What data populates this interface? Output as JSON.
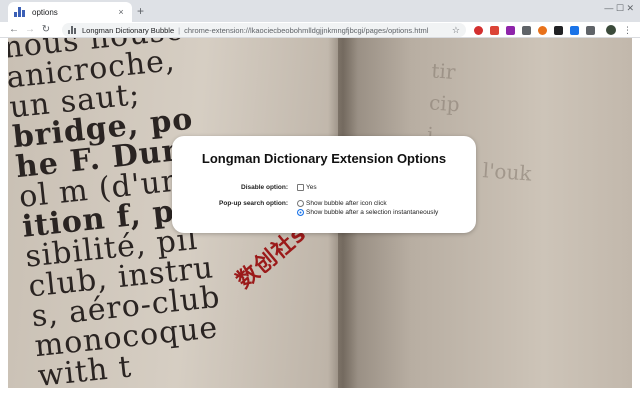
{
  "browser": {
    "tab": {
      "title": "options",
      "close": "×"
    },
    "new_tab": "+",
    "window_controls": "— ☐ ✕",
    "nav": {
      "back": "←",
      "forward": "→",
      "reload": "↻"
    },
    "address": {
      "site_name": "Longman Dictionary Bubble",
      "separator": "|",
      "url": "chrome-extension://lkaociecbeobohmlldgjjnkmngfjbcgi/pages/options.html",
      "star": "☆"
    },
    "extensions": [
      {
        "icon": "abp-icon",
        "color": "#d32f2f",
        "round": true
      },
      {
        "icon": "gmail-icon",
        "color": "#db4437",
        "round": false
      },
      {
        "icon": "pen-icon",
        "color": "#8e24aa",
        "round": false
      },
      {
        "icon": "puzzle-icon",
        "color": "#5f6368",
        "round": false
      },
      {
        "icon": "circle-icon",
        "color": "#e8711a",
        "round": true
      },
      {
        "icon": "badge-icon",
        "color": "#202124",
        "round": false
      },
      {
        "icon": "v-icon",
        "color": "#1a73e8",
        "round": false
      },
      {
        "icon": "menu-icon",
        "color": "#5f6368",
        "round": false
      }
    ],
    "menu": "⋮"
  },
  "book_text": {
    "left_lines": [
      "nous nouse",
      "anicroche,",
      "un saut; ",
      "bridge, po",
      "he F. Dum",
      "ol m (d'un",
      "ition f, pilo",
      "sibilité, pil",
      "club, instru",
      "s, aéro-club",
      "monocoque",
      "with t"
    ],
    "right_lines": [
      "tir",
      "cip",
      "i",
      "Mod. l'ouk"
    ]
  },
  "watermark": "数创社scs66",
  "options": {
    "title": "Longman Dictionary Extension Options",
    "disable_label": "Disable option:",
    "disable_yes": "Yes",
    "popup_label": "Pop-up search option:",
    "popup_icon_click": "Show bubble after icon click",
    "popup_selection": "Show bubble after a selection instantaneously",
    "selected": "selection"
  }
}
